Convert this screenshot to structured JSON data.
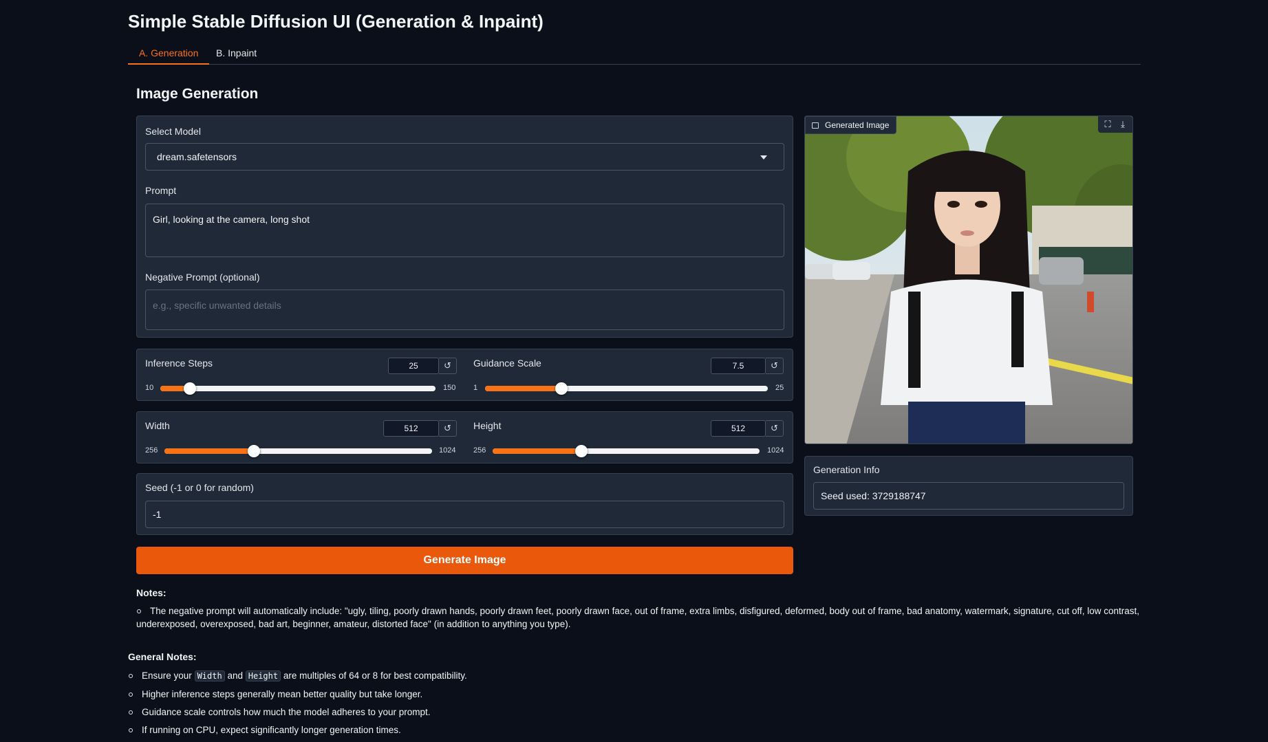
{
  "app": {
    "title": "Simple Stable Diffusion UI (Generation & Inpaint)"
  },
  "tabs": [
    {
      "label": "A. Generation",
      "active": true
    },
    {
      "label": "B. Inpaint",
      "active": false
    }
  ],
  "section": {
    "title": "Image Generation"
  },
  "model": {
    "label": "Select Model",
    "value": "dream.safetensors"
  },
  "prompt": {
    "label": "Prompt",
    "value": "Girl, looking at the camera, long shot"
  },
  "negative_prompt": {
    "label": "Negative Prompt (optional)",
    "placeholder": "e.g., specific unwanted details",
    "value": ""
  },
  "sliders": {
    "inference_steps": {
      "label": "Inference Steps",
      "value": "25",
      "min": "10",
      "max": "150",
      "fraction": 0.1071
    },
    "guidance_scale": {
      "label": "Guidance Scale",
      "value": "7.5",
      "min": "1",
      "max": "25",
      "fraction": 0.2708
    },
    "width": {
      "label": "Width",
      "value": "512",
      "min": "256",
      "max": "1024",
      "fraction": 0.3333
    },
    "height": {
      "label": "Height",
      "value": "512",
      "min": "256",
      "max": "1024",
      "fraction": 0.3333
    }
  },
  "reset_icon": "↺",
  "seed": {
    "label": "Seed (-1 or 0 for random)",
    "value": "-1"
  },
  "generate_button": {
    "label": "Generate Image"
  },
  "output": {
    "image_label": "Generated Image",
    "fullscreen_icon": "fullscreen-icon",
    "download_icon": "download-icon"
  },
  "generation_info": {
    "label": "Generation Info",
    "value": "Seed used: 3729188747"
  },
  "notes": {
    "title": "Notes:",
    "item_line1": "The negative prompt will automatically include: \"ugly, tiling, poorly drawn hands, poorly drawn feet, poorly drawn face, out of frame, extra limbs, disfigured, deformed, body out of frame, bad anatomy, watermark, signature, cut off, low contrast,",
    "item_line2": "underexposed, overexposed, bad art, beginner, amateur, distorted face\" (in addition to anything you type)."
  },
  "general_notes": {
    "title": "General Notes:",
    "item1_pre": "Ensure your",
    "item1_code1": "Width",
    "item1_mid": "and",
    "item1_code2": "Height",
    "item1_post": "are multiples of 64 or 8 for best compatibility.",
    "item2": "Higher inference steps generally mean better quality but take longer.",
    "item3": "Guidance scale controls how much the model adheres to your prompt.",
    "item4": "If running on CPU, expect significantly longer generation times."
  },
  "colors": {
    "accent": "#f97316",
    "button": "#ea580c",
    "background": "#0b0f19",
    "panel": "#1f2937"
  }
}
